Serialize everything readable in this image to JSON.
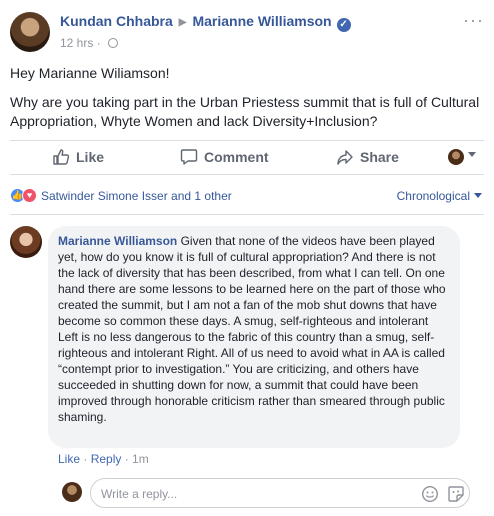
{
  "post": {
    "author": "Kundan Chhabra",
    "target": "Marianne Williamson",
    "time": "12 hrs",
    "paragraphs": [
      "Hey Marianne Wiliamson!",
      "Why are you taking part in the Urban Priestess summit that is full of Cultural Appropriation, Whyte Women and lack Diversity+Inclusion?"
    ]
  },
  "actions": {
    "like": "Like",
    "comment": "Comment",
    "share": "Share"
  },
  "reactions": {
    "names": "Satwinder Simone Isser and 1 other",
    "sort": "Chronological"
  },
  "comment": {
    "author": "Marianne Williamson",
    "text": "Given that none of the videos have been played yet, how do you know it is full of cultural appropriation? And there is not the lack of diversity that has been described, from what I can tell. On one hand there are some lessons to be learned here on the part of those who created the summit, but I am not a fan of the mob shut downs that have become so common these days. A smug, self-righteous and intolerant Left is no less dangerous to the fabric of this country than a smug, self-righteous and intolerant Right. All of us need to avoid what in AA is called “contempt prior to investigation.” You are criticizing, and others have succeeded in shutting down for now, a summit that could have been improved through honorable criticism rather than smeared through public shaming.",
    "like": "Like",
    "reply": "Reply",
    "time": "1m"
  },
  "reply_box": {
    "placeholder": "Write a reply..."
  },
  "colors": {
    "link": "#365899",
    "like_blue": "#4a8af4",
    "love_red": "#f25268",
    "bubble": "#f2f3f5"
  },
  "icons": [
    "verified-icon",
    "globe-icon",
    "more-icon",
    "like-icon",
    "comment-icon",
    "share-icon",
    "emoji-icon",
    "sticker-icon"
  ]
}
